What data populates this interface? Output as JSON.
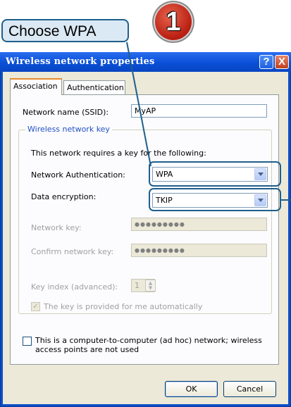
{
  "callout": {
    "text": "Choose WPA"
  },
  "step": {
    "number": "1"
  },
  "window": {
    "title": "Wireless network properties",
    "help_label": "?",
    "close_label": "X"
  },
  "tabs": [
    {
      "label": "Association",
      "active": true
    },
    {
      "label": "Authentication",
      "active": false
    }
  ],
  "form": {
    "ssid_label": "Network name (SSID):",
    "ssid_value": "MyAP",
    "group_title": "Wireless network key",
    "requires_text": "This network requires a key for the following:",
    "auth_label": "Network Authentication:",
    "auth_value": "WPA",
    "enc_label": "Data encryption:",
    "enc_value": "TKIP",
    "netkey_label": "Network key:",
    "netkey_value": "●●●●●●●●●",
    "confirm_label": "Confirm network key:",
    "confirm_value": "●●●●●●●●●",
    "keyindex_label": "Key index (advanced):",
    "keyindex_value": "1",
    "auto_key_label": "The key is provided for me automatically",
    "auto_key_checked": true,
    "adhoc_label_line1": "This is a computer-to-computer (ad hoc) network; wireless",
    "adhoc_label_line2": "access points are not used",
    "adhoc_checked": false
  },
  "buttons": {
    "ok": "OK",
    "cancel": "Cancel"
  },
  "colors": {
    "callout_border": "#1f5f8c",
    "titlebar": "#0a4fd6",
    "step_badge": "#c8261a"
  }
}
